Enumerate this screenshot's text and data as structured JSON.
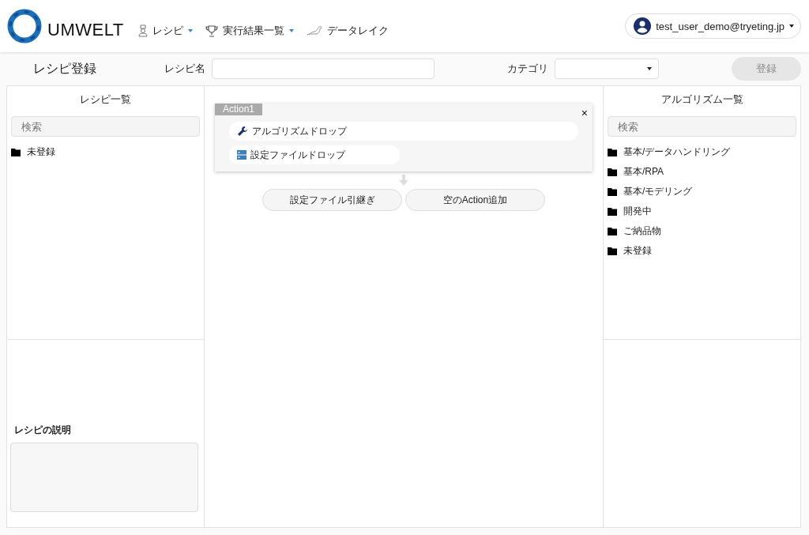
{
  "header": {
    "logo_text": "UMWELT",
    "nav": [
      {
        "label": "レシピ",
        "kind": "recipe",
        "dropdown": true
      },
      {
        "label": "実行結果一覧",
        "kind": "results",
        "dropdown": true
      },
      {
        "label": "データレイク",
        "kind": "datalake",
        "dropdown": false
      }
    ],
    "user": {
      "email": "test_user_demo@tryeting.jp"
    }
  },
  "toolbar": {
    "title": "レシピ登録",
    "name_label": "レシピ名",
    "category_label": "カテゴリ",
    "register_button": {
      "label": "登録",
      "disabled": true
    }
  },
  "recipe_panel": {
    "title": "レシピ一覧",
    "search": {
      "placeholder": "検索"
    },
    "folders": [
      {
        "label": "未登録"
      }
    ],
    "description_label": "レシピの説明"
  },
  "canvas": {
    "actions": [
      {
        "title": "Action1",
        "close": "×",
        "slots": [
          {
            "kind": "algorithm",
            "label": "アルゴリズムドロップ"
          },
          {
            "kind": "config",
            "label": "設定ファイルドロップ"
          }
        ]
      }
    ],
    "buttons": [
      "設定ファイル引継ぎ",
      "空のAction追加"
    ]
  },
  "algorithm_panel": {
    "title": "アルゴリズム一覧",
    "search": {
      "placeholder": "検索"
    },
    "folders": [
      {
        "label": "基本/データハンドリング"
      },
      {
        "label": "基本/RPA"
      },
      {
        "label": "基本/モデリング"
      },
      {
        "label": "開発中"
      },
      {
        "label": "ご納品物"
      },
      {
        "label": "未登録"
      }
    ]
  }
}
